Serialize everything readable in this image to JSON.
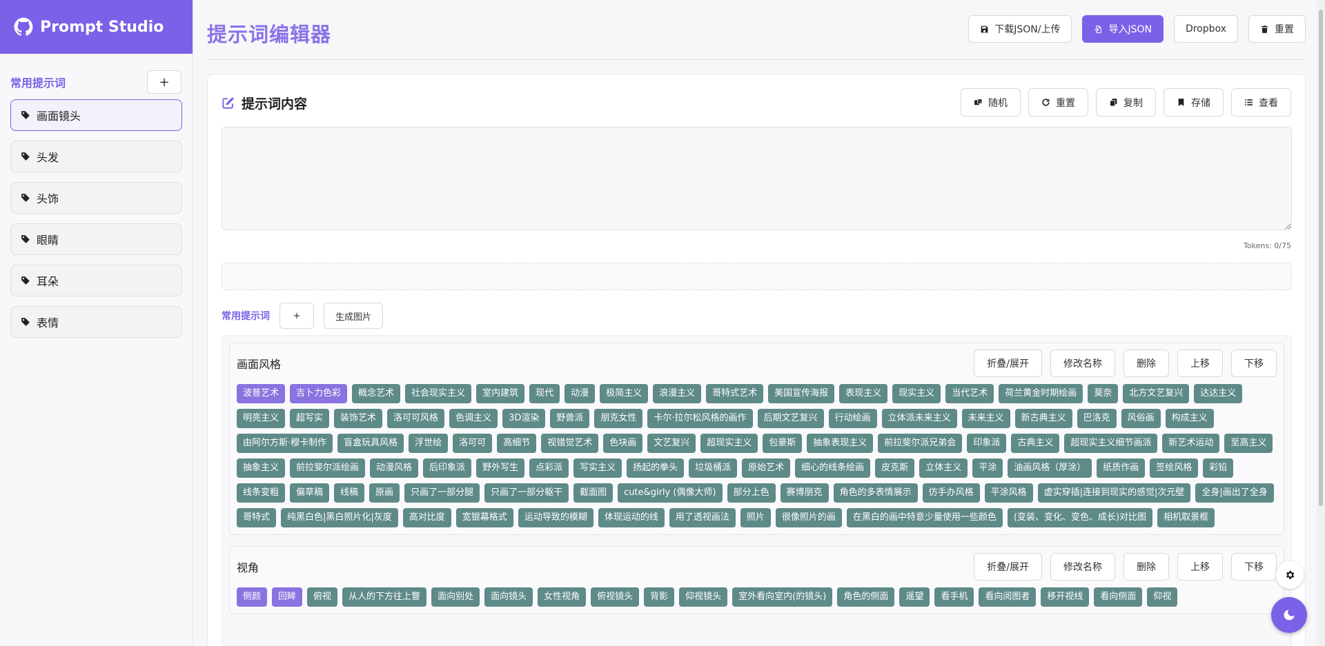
{
  "app": {
    "name": "Prompt Studio",
    "accent": "#7b61e8",
    "tag_color": "#5e8a87",
    "tag_selected_color": "#8a72e0"
  },
  "sidebar": {
    "title": "常用提示词",
    "add_label": "+",
    "items": [
      {
        "label": "画面镜头",
        "icon": "tag-icon",
        "active": true
      },
      {
        "label": "头发",
        "icon": "tag-icon"
      },
      {
        "label": "头饰",
        "icon": "tag-icon"
      },
      {
        "label": "眼睛",
        "icon": "tag-icon"
      },
      {
        "label": "耳朵",
        "icon": "tag-icon"
      },
      {
        "label": "表情",
        "icon": "tag-icon"
      }
    ]
  },
  "header": {
    "title": "提示词编辑器",
    "actions": [
      {
        "label": "下载JSON/上传",
        "icon": "floppy-icon"
      },
      {
        "label": "导入JSON",
        "icon": "file-import-icon",
        "primary": true
      },
      {
        "label": "Dropbox"
      },
      {
        "label": "重置",
        "icon": "trash-icon"
      }
    ]
  },
  "editor": {
    "title": "提示词内容",
    "title_icon": "edit-icon",
    "actions": [
      {
        "label": "随机",
        "icon": "dice-icon"
      },
      {
        "label": "重置",
        "icon": "redo-icon"
      },
      {
        "label": "复制",
        "icon": "copy-icon"
      },
      {
        "label": "存储",
        "icon": "bookmark-icon"
      },
      {
        "label": "查看",
        "icon": "list-icon"
      }
    ],
    "prompt_value": "",
    "tokens": "Tokens: 0/75"
  },
  "favorites": {
    "label": "常用提示词",
    "add_label": "+",
    "generate_label": "生成图片"
  },
  "category_buttons": [
    "折叠/展开",
    "修改名称",
    "删除",
    "上移",
    "下移"
  ],
  "categories": [
    {
      "name": "画面风格",
      "tags": [
        {
          "t": "波普艺术",
          "sel": true
        },
        {
          "t": "吉卜力色彩",
          "sel": true
        },
        {
          "t": "概念艺术"
        },
        {
          "t": "社会现实主义"
        },
        {
          "t": "室内建筑"
        },
        {
          "t": "现代"
        },
        {
          "t": "动漫"
        },
        {
          "t": "极简主义"
        },
        {
          "t": "浪漫主义"
        },
        {
          "t": "哥特式艺术"
        },
        {
          "t": "美国宣传海报"
        },
        {
          "t": "表现主义"
        },
        {
          "t": "现实主义"
        },
        {
          "t": "当代艺术"
        },
        {
          "t": "荷兰黄金时期绘画"
        },
        {
          "t": "莫奈"
        },
        {
          "t": "北方文艺复兴"
        },
        {
          "t": "达达主义"
        },
        {
          "t": "明亮主义"
        },
        {
          "t": "超写实"
        },
        {
          "t": "装饰艺术"
        },
        {
          "t": "洛可可风格"
        },
        {
          "t": "色调主义"
        },
        {
          "t": "3D渲染"
        },
        {
          "t": "野兽派"
        },
        {
          "t": "朋克女性"
        },
        {
          "t": "卡尔·拉尔松风格的画作"
        },
        {
          "t": "后期文艺复兴"
        },
        {
          "t": "行动绘画"
        },
        {
          "t": "立体派未来主义"
        },
        {
          "t": "未来主义"
        },
        {
          "t": "新古典主义"
        },
        {
          "t": "巴洛克"
        },
        {
          "t": "风俗画"
        },
        {
          "t": "构成主义"
        },
        {
          "t": "由阿尔方斯·穆卡制作"
        },
        {
          "t": "盲盒玩具风格"
        },
        {
          "t": "浮世绘"
        },
        {
          "t": "洛可可"
        },
        {
          "t": "高细节"
        },
        {
          "t": "视错觉艺术"
        },
        {
          "t": "色块画"
        },
        {
          "t": "文艺复兴"
        },
        {
          "t": "超现实主义"
        },
        {
          "t": "包豪斯"
        },
        {
          "t": "抽象表现主义"
        },
        {
          "t": "前拉斐尔派兄弟会"
        },
        {
          "t": "印象派"
        },
        {
          "t": "古典主义"
        },
        {
          "t": "超现实主义细节画派"
        },
        {
          "t": "新艺术运动"
        },
        {
          "t": "至高主义"
        },
        {
          "t": "抽象主义"
        },
        {
          "t": "前拉斐尔派绘画"
        },
        {
          "t": "动漫风格"
        },
        {
          "t": "后印象派"
        },
        {
          "t": "野外写生"
        },
        {
          "t": "点彩派"
        },
        {
          "t": "写实主义"
        },
        {
          "t": "扬起的拳头"
        },
        {
          "t": "垃圾桶派"
        },
        {
          "t": "原始艺术"
        },
        {
          "t": "细心的线条绘画"
        },
        {
          "t": "皮克斯"
        },
        {
          "t": "立体主义"
        },
        {
          "t": "平涂"
        },
        {
          "t": "油画风格（厚涂）"
        },
        {
          "t": "纸质作画"
        },
        {
          "t": "签绘风格"
        },
        {
          "t": "彩铅"
        },
        {
          "t": "线条变粗"
        },
        {
          "t": "偏草稿"
        },
        {
          "t": "线稿"
        },
        {
          "t": "原画"
        },
        {
          "t": "只画了一部分腿"
        },
        {
          "t": "只画了一部分躯干"
        },
        {
          "t": "截面图"
        },
        {
          "t": "cute&girly (偶像大师)"
        },
        {
          "t": "部分上色"
        },
        {
          "t": "赛博朋克"
        },
        {
          "t": "角色的多表情展示"
        },
        {
          "t": "仿手办风格"
        },
        {
          "t": "平涂风格"
        },
        {
          "t": "虚实穿插|连接到现实的感觉|次元壁"
        },
        {
          "t": "全身|画出了全身"
        },
        {
          "t": "哥特式"
        },
        {
          "t": "纯黑白色|黑白照片化|灰度"
        },
        {
          "t": "高对比度"
        },
        {
          "t": "宽银幕格式"
        },
        {
          "t": "运动导致的模糊"
        },
        {
          "t": "体现运动的线"
        },
        {
          "t": "用了透视画法"
        },
        {
          "t": "照片"
        },
        {
          "t": "很像照片的画"
        },
        {
          "t": "在黑白的画中特意少量使用一些颜色"
        },
        {
          "t": "(变装、变化、变色、成长)对比图"
        },
        {
          "t": "相机取景框"
        }
      ]
    },
    {
      "name": "视角",
      "tags": [
        {
          "t": "侧颜",
          "sel": true
        },
        {
          "t": "回眸",
          "sel": true
        },
        {
          "t": "俯视"
        },
        {
          "t": "从人的下方往上瞥"
        },
        {
          "t": "面向别处"
        },
        {
          "t": "面向镜头"
        },
        {
          "t": "女性视角"
        },
        {
          "t": "俯视镜头"
        },
        {
          "t": "背影"
        },
        {
          "t": "仰视镜头"
        },
        {
          "t": "室外看向室内(的镜头)"
        },
        {
          "t": "角色的侧面"
        },
        {
          "t": "遥望"
        },
        {
          "t": "看手机"
        },
        {
          "t": "看向阅图者"
        },
        {
          "t": "移开视线"
        },
        {
          "t": "看向侧面"
        },
        {
          "t": "仰视"
        }
      ]
    }
  ]
}
